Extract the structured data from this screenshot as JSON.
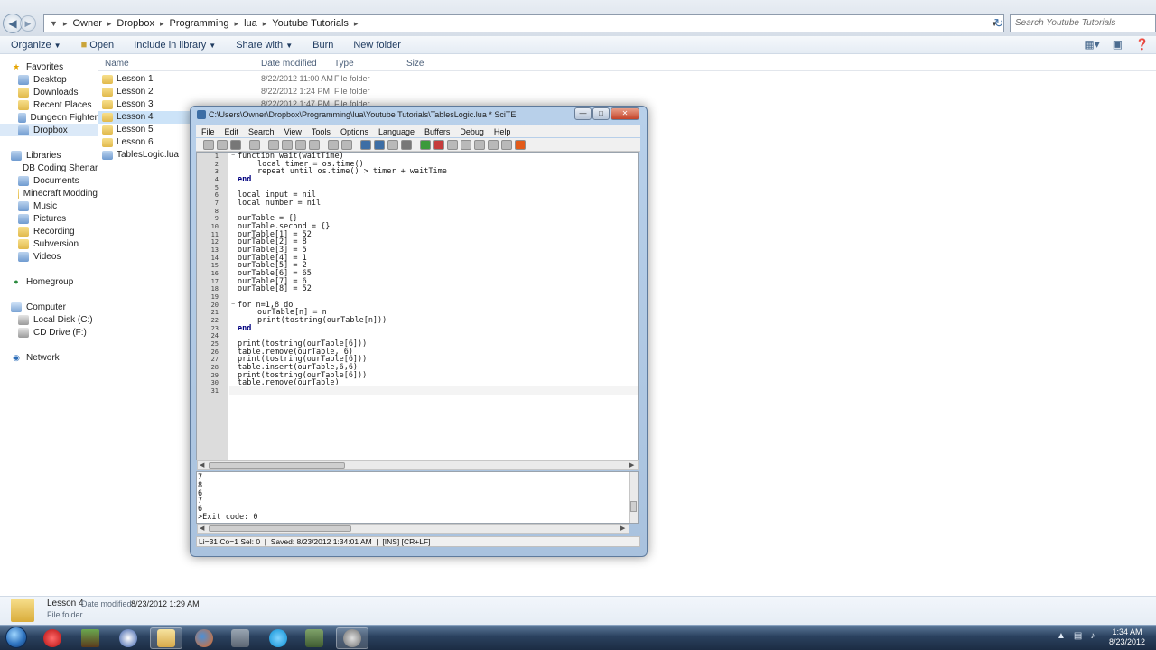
{
  "explorer": {
    "breadcrumb": [
      "Owner",
      "Dropbox",
      "Programming",
      "lua",
      "Youtube Tutorials"
    ],
    "search_placeholder": "Search Youtube Tutorials",
    "toolbar": {
      "organize": "Organize",
      "open": "Open",
      "include": "Include in library",
      "share": "Share with",
      "burn": "Burn",
      "new_folder": "New folder"
    },
    "nav": {
      "favorites": "Favorites",
      "desktop": "Desktop",
      "downloads": "Downloads",
      "recent": "Recent Places",
      "dungeon": "Dungeon Fighter",
      "dropbox": "Dropbox",
      "libraries": "Libraries",
      "lib1": "DB Coding Shenani",
      "lib2": "Documents",
      "lib3": "Minecraft Modding",
      "lib4": "Music",
      "lib5": "Pictures",
      "lib6": "Recording",
      "lib7": "Subversion",
      "lib8": "Videos",
      "homegroup": "Homegroup",
      "computer": "Computer",
      "local_disk": "Local Disk (C:)",
      "cd_drive": "CD Drive (F:)",
      "network": "Network"
    },
    "columns": {
      "name": "Name",
      "date": "Date modified",
      "type": "Type",
      "size": "Size"
    },
    "files": [
      {
        "name": "Lesson 1",
        "date": "8/22/2012 11:00 AM",
        "type": "File folder"
      },
      {
        "name": "Lesson 2",
        "date": "8/22/2012 1:24 PM",
        "type": "File folder"
      },
      {
        "name": "Lesson 3",
        "date": "8/22/2012 1:47 PM",
        "type": "File folder"
      },
      {
        "name": "Lesson 4",
        "date": "",
        "type": ""
      },
      {
        "name": "Lesson 5",
        "date": "",
        "type": ""
      },
      {
        "name": "Lesson 6",
        "date": "",
        "type": ""
      },
      {
        "name": "TablesLogic.lua",
        "date": "",
        "type": ""
      }
    ],
    "details": {
      "name": "Lesson 4",
      "modified_label": "Date modified:",
      "modified": "8/23/2012 1:29 AM",
      "type": "File folder"
    }
  },
  "scite": {
    "title": "C:\\Users\\Owner\\Dropbox\\Programming\\lua\\Youtube Tutorials\\TablesLogic.lua * SciTE",
    "menu": [
      "File",
      "Edit",
      "Search",
      "View",
      "Tools",
      "Options",
      "Language",
      "Buffers",
      "Debug",
      "Help"
    ],
    "code": {
      "l1": "function wait(waitTime)",
      "l2": "local timer = os.time()",
      "l3": "repeat until os.time() > timer + waitTime",
      "l4": "end",
      "l6": "local input = nil",
      "l7": "local number = nil",
      "l9": "ourTable = {}",
      "l10": "ourTable.second = {}",
      "l11": "ourTable[1] = 52",
      "l12": "ourTable[2] = 8",
      "l13": "ourTable[3] = 5",
      "l14": "ourTable[4] = 1",
      "l15": "ourTable[5] = 2",
      "l16": "ourTable[6] = 65",
      "l17": "ourTable[7] = 6",
      "l18": "ourTable[8] = 52",
      "l20": "for n=1,8 do",
      "l21": "ourTable[n] = n",
      "l22": "print(tostring(ourTable[n]))",
      "l23": "end",
      "l25": "print(tostring(ourTable[6]))",
      "l26": "table.remove(ourTable, 6)",
      "l27": "print(tostring(ourTable[6]))",
      "l28": "table.insert(ourTable,6,6)",
      "l29": "print(tostring(ourTable[6]))",
      "l30": "table.remove(ourTable)"
    },
    "line_numbers": [
      "1",
      "2",
      "3",
      "4",
      "5",
      "6",
      "7",
      "8",
      "9",
      "10",
      "11",
      "12",
      "13",
      "14",
      "15",
      "16",
      "17",
      "18",
      "19",
      "20",
      "21",
      "22",
      "23",
      "24",
      "25",
      "26",
      "27",
      "28",
      "29",
      "30",
      "31"
    ],
    "output": [
      "7",
      "8",
      "6",
      "7",
      "6",
      ">Exit code: 0"
    ],
    "status": "Li=31 Co=1 Sel: 0  |  Saved: 8/23/2012 1:34:01 AM  |  [INS] [CR+LF]"
  },
  "clock": {
    "time": "1:34 AM",
    "date": "8/23/2012"
  }
}
